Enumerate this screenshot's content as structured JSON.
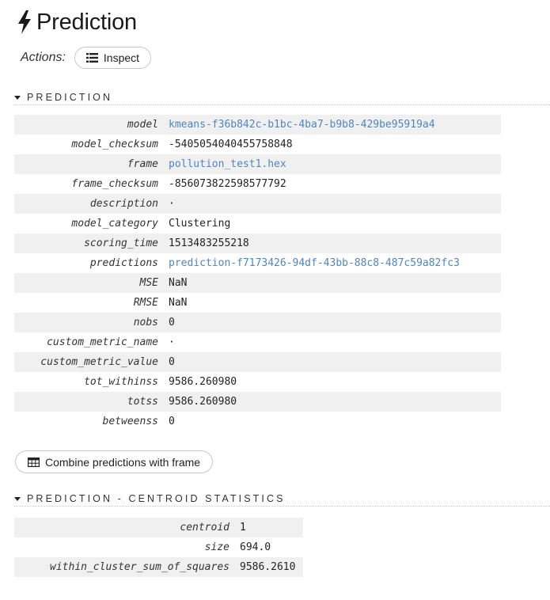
{
  "header": {
    "title": "Prediction",
    "icon": "bolt-icon"
  },
  "actions": {
    "label": "Actions:",
    "inspect_label": "Inspect",
    "inspect_icon": "list-icon"
  },
  "prediction_section": {
    "title": "PREDICTION",
    "rows": [
      {
        "key": "model",
        "value": "kmeans-f36b842c-b1bc-4ba7-b9b8-429be95919a4",
        "link": true
      },
      {
        "key": "model_checksum",
        "value": "-5405054040455758848",
        "link": false
      },
      {
        "key": "frame",
        "value": "pollution_test1.hex",
        "link": true
      },
      {
        "key": "frame_checksum",
        "value": "-856073822598577792",
        "link": false
      },
      {
        "key": "description",
        "value": "·",
        "link": false
      },
      {
        "key": "model_category",
        "value": "Clustering",
        "link": false
      },
      {
        "key": "scoring_time",
        "value": "1513483255218",
        "link": false
      },
      {
        "key": "predictions",
        "value": "prediction-f7173426-94df-43bb-88c8-487c59a82fc3",
        "link": true
      },
      {
        "key": "MSE",
        "value": "NaN",
        "link": false
      },
      {
        "key": "RMSE",
        "value": "NaN",
        "link": false
      },
      {
        "key": "nobs",
        "value": "0",
        "link": false
      },
      {
        "key": "custom_metric_name",
        "value": "·",
        "link": false
      },
      {
        "key": "custom_metric_value",
        "value": "0",
        "link": false
      },
      {
        "key": "tot_withinss",
        "value": "9586.260980",
        "link": false
      },
      {
        "key": "totss",
        "value": "9586.260980",
        "link": false
      },
      {
        "key": "betweenss",
        "value": "0",
        "link": false
      }
    ]
  },
  "combine": {
    "label": "Combine predictions with frame",
    "icon": "table-icon"
  },
  "centroid_section": {
    "title": "PREDICTION - CENTROID STATISTICS",
    "rows": [
      {
        "key": "centroid",
        "value": "1"
      },
      {
        "key": "size",
        "value": "694.0"
      },
      {
        "key": "within_cluster_sum_of_squares",
        "value": "9586.2610"
      }
    ]
  },
  "colors": {
    "link": "#4f86c0",
    "row_stripe": "#f0f0f0"
  }
}
